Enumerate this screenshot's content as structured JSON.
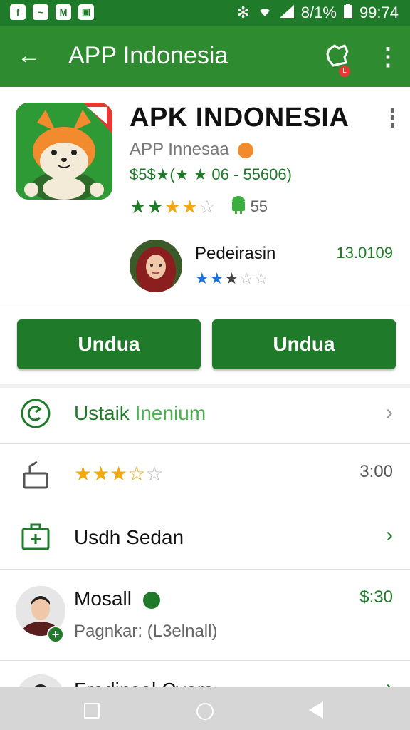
{
  "status_bar": {
    "left_icons": [
      "f",
      "~",
      "M",
      "▣"
    ],
    "battery_percent": "8/1%",
    "time": "99:74"
  },
  "app_bar": {
    "title": "APP Indonesia",
    "notification_badge": "L"
  },
  "app": {
    "name": "APK INDONESIA",
    "developer": "APP Innesaa",
    "meta": "$5$★(★ ★ 06 - 55606)",
    "rating_stars": "★★★★☆",
    "android_count": "55"
  },
  "reviewer": {
    "name": "Pedeirasin",
    "value": "13.0109",
    "stars": "★★★☆☆"
  },
  "buttons": {
    "left": "Undua",
    "right": "Undua"
  },
  "rows": [
    {
      "label_primary": "Ustaik",
      "label_secondary": "Inenium"
    },
    {
      "stars": "★★★☆☆",
      "time": "3:00"
    },
    {
      "label": "Usdh Sedan"
    },
    {
      "title": "Mosall",
      "subtitle": "Pagnkar: (L3elnall)",
      "price": "$:30"
    },
    {
      "title": "Frodinsal Cyars"
    }
  ],
  "colors": {
    "primary": "#2e8b30",
    "primary_dark": "#1f7a2a",
    "star": "#f2a90f",
    "star_blue": "#1e73d8"
  }
}
